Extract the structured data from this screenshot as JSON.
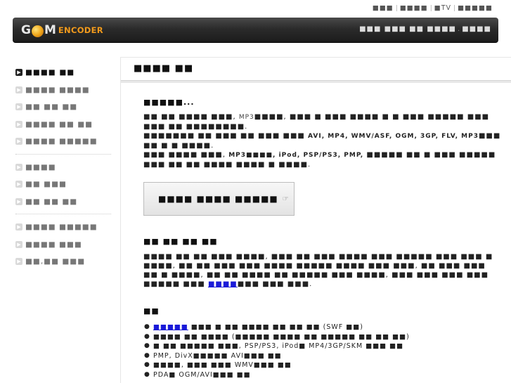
{
  "top_links": {
    "items": [
      "■■■",
      "■■■■",
      "■TV",
      "■■■■■"
    ]
  },
  "header": {
    "logo_part1": "G",
    "logo_part2": "M",
    "logo_suffix": "ENCODER",
    "nav_text": "■■■ ■■■ ■■ ■■■■",
    "nav_link": "■■■■"
  },
  "sidebar": {
    "groups": [
      [
        "■■■■ ■■",
        "■■■■ ■■■■",
        "■■ ■■ ■■",
        "■■■■ ■■ ■■",
        "■■■■ ■■■■■"
      ],
      [
        "■■■■",
        "■■ ■■■",
        "■■ ■■ ■■"
      ],
      [
        "■■■■ ■■■■■",
        "■■■■ ■■■",
        "■■,■■ ■■■"
      ]
    ]
  },
  "content": {
    "page_title": "■■■■ ■■",
    "section1": {
      "title": "■■■■■...",
      "line1_a": "■■ ■■ ■■■■ ■■■, ",
      "line1_mp3": "MP3",
      "line1_b": "■■■■, ■■■ ■ ■■■ ■■■■ ■ ■ ■■■ ■■■■■ ■■■ ■■■ ■■ ■■■■■■■■.",
      "line2_a": "■■■■■■■ ■■ ■■■ ■■ ■■■ ■■■ ",
      "line2_formats": "AVI, MP4, WMV/ASF, OGM, 3GP, FLV, MP3",
      "line2_b": "■■■ ■■ ■ ■ ■■■■.",
      "line3_a": "■■■ ■■■■ ■■■, ",
      "line3_devices": "MP3■■■■, iPod, PSP/PS3, PMP,",
      "line3_b": " ■■■■■ ■■ ■ ■■■ ■■■■■ ■■■ ■■ ■■ ■■■■ ■■■■ ■ ■■■■."
    },
    "action_button": "■■■■ ■■■■ ■■■■■",
    "action_hand": "☞",
    "section2": {
      "title": "■■ ■■ ■■ ■■",
      "text": "■■■■ ■■ ■■ ■■■ ■■■■, ■■■ ■■ ■■■ ■■■■ ■■■ ■■■■■ ■■■ ■■■ ■ ■■■■, ■■ ■■ ■■■ ■■■ ■■■■ ■■■■■ ■■■■ ■■■ ■■■, ■■ ■■■ ■■■ ■■ ■ ■■■■, ■■ ■■ ■■■■ ■■ ■■■■■ ■■■ ■■■■, ■■■ ■■■ ■■■ ■■■ ■■■■■ ■■■ ",
      "link": "■■■■",
      "tail": "■■■ ■■■ ■■■."
    },
    "section3": {
      "title": "■■",
      "features": [
        {
          "link": "■■■■■",
          "text": " ■■■ ■ ■■ ■■■■ ■■ ■■ ■■ (SWF ■■)"
        },
        {
          "link": "",
          "text": "■■■■ ■■ ■■■■ (■■■■■ ■■■■ ■■ ■■■■■ ■■ ■■ ■■)"
        },
        {
          "link": "",
          "text": "■ ■■ ■■■■■ ■■■, PSP/PS3, iPod■ MP4/3GP/SKM ■■■ ■■"
        },
        {
          "link": "",
          "text": "PMP, DivX■■■■■ AVI■■■ ■■"
        },
        {
          "link": "",
          "text": "■■■■, ■■■ ■■■ WMV■■■ ■■"
        },
        {
          "link": "",
          "text": "PDA■ OGM/AVI■■■ ■■"
        }
      ]
    }
  }
}
